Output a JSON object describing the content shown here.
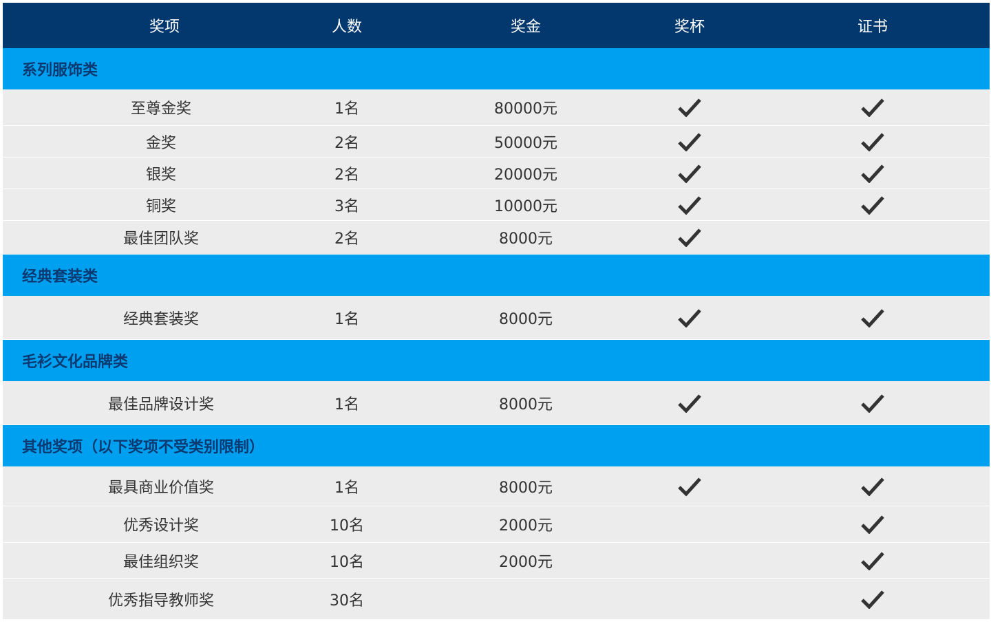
{
  "header": {
    "award": "奖项",
    "count": "人数",
    "prize": "奖金",
    "cup": "奖杯",
    "cert": "证书"
  },
  "colors": {
    "header_bg": "#03386f",
    "category_bg": "#00a0f0",
    "category_text": "#0b3a72",
    "row_bg": "#ececec",
    "check": "#333333"
  },
  "categories": [
    {
      "label": "系列服饰类",
      "rows": [
        {
          "name": "至尊金奖",
          "count": "1名",
          "prize": "80000元",
          "cup": true,
          "cert": true
        },
        {
          "name": "金奖",
          "count": "2名",
          "prize": "50000元",
          "cup": true,
          "cert": true
        },
        {
          "name": "银奖",
          "count": "2名",
          "prize": "20000元",
          "cup": true,
          "cert": true
        },
        {
          "name": "铜奖",
          "count": "3名",
          "prize": "10000元",
          "cup": true,
          "cert": true
        },
        {
          "name": "最佳团队奖",
          "count": "2名",
          "prize": "8000元",
          "cup": true,
          "cert": false
        }
      ]
    },
    {
      "label": "经典套装类",
      "rows": [
        {
          "name": "经典套装奖",
          "count": "1名",
          "prize": "8000元",
          "cup": true,
          "cert": true
        }
      ]
    },
    {
      "label": "毛衫文化品牌类",
      "rows": [
        {
          "name": "最佳品牌设计奖",
          "count": "1名",
          "prize": "8000元",
          "cup": true,
          "cert": true
        }
      ]
    },
    {
      "label": "其他奖项（以下奖项不受类别限制）",
      "rows": [
        {
          "name": "最具商业价值奖",
          "count": "1名",
          "prize": "8000元",
          "cup": true,
          "cert": true
        },
        {
          "name": "优秀设计奖",
          "count": "10名",
          "prize": "2000元",
          "cup": false,
          "cert": true
        },
        {
          "name": "最佳组织奖",
          "count": "10名",
          "prize": "2000元",
          "cup": false,
          "cert": true
        },
        {
          "name": "优秀指导教师奖",
          "count": "30名",
          "prize": "",
          "cup": false,
          "cert": true
        }
      ]
    }
  ]
}
